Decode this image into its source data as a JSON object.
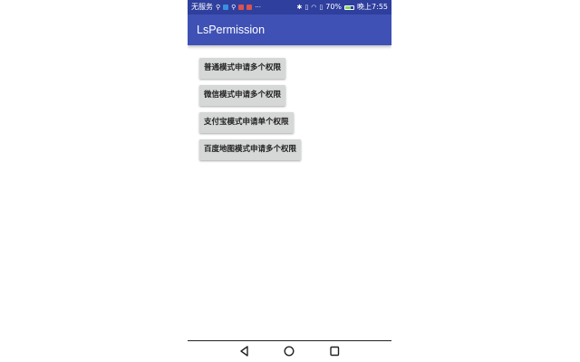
{
  "statusbar": {
    "carrier": "无服务",
    "battery": "70%",
    "time": "晚上7:55",
    "extra": "···"
  },
  "appbar": {
    "title": "LsPermission"
  },
  "buttons": [
    {
      "label": "普通模式申请多个权限"
    },
    {
      "label": "微信模式申请多个权限"
    },
    {
      "label": "支付宝模式申请单个权限"
    },
    {
      "label": "百度地图模式申请多个权限"
    }
  ],
  "navbar": {
    "back_icon": "triangle-back-icon",
    "home_icon": "circle-home-icon",
    "recents_icon": "square-recents-icon"
  }
}
